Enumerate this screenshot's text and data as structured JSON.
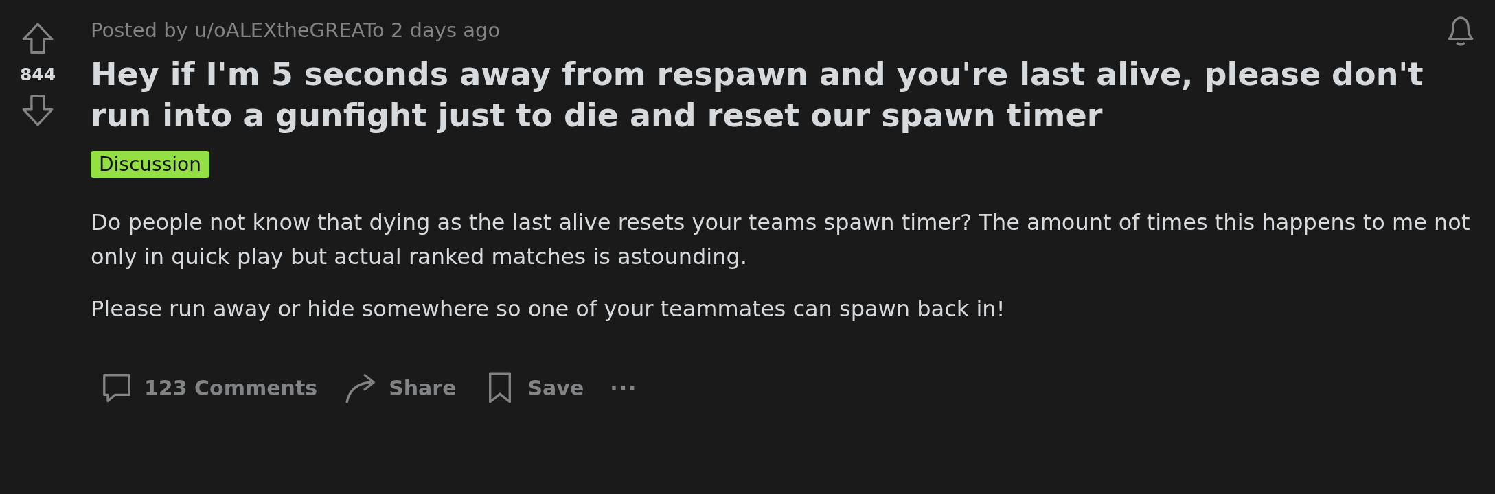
{
  "post": {
    "score": "844",
    "posted_by": "Posted by u/oALEXtheGREATo 2 days ago",
    "title": "Hey if I'm 5 seconds away from respawn and you're last alive, please don't run into a gunfight just to die and reset our spawn timer",
    "flair": {
      "label": "Discussion",
      "color": "#94e044"
    },
    "body": [
      "Do people not know that dying as the last alive resets your teams spawn timer? The amount of times this happens to me not only in quick play but actual ranked matches is astounding.",
      "Please run away or hide somewhere so one of your teammates can spawn back in!"
    ],
    "actions": [
      {
        "kind": "comments",
        "label": "123 Comments"
      },
      {
        "kind": "share",
        "label": "Share"
      },
      {
        "kind": "save",
        "label": "Save"
      },
      {
        "kind": "more",
        "label": "···"
      }
    ]
  }
}
